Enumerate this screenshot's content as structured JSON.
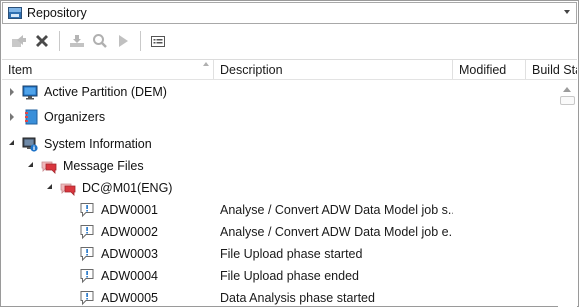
{
  "window": {
    "title": "Repository"
  },
  "toolbar": {
    "buttons": [
      {
        "icon": "open-arrow-icon",
        "enabled": false
      },
      {
        "icon": "delete-x-icon",
        "enabled": true
      },
      {
        "icon": "import-download-icon",
        "enabled": false
      },
      {
        "icon": "search-icon",
        "enabled": false
      },
      {
        "icon": "play-icon",
        "enabled": false
      },
      {
        "icon": "properties-list-icon",
        "enabled": true
      }
    ]
  },
  "columns": [
    "Item",
    "Description",
    "Modified",
    "Build Sta"
  ],
  "tree": [
    {
      "label": "Active Partition (DEM)",
      "description": "",
      "icon": "monitor-icon",
      "expander": "collapsed"
    },
    {
      "label": "Organizers",
      "description": "",
      "icon": "organizer-book-icon",
      "expander": "collapsed"
    },
    {
      "label": "System Information",
      "description": "",
      "icon": "system-info-icon",
      "expander": "expanded"
    },
    {
      "label": "Message Files",
      "description": "",
      "icon": "message-files-icon",
      "expander": "expanded"
    },
    {
      "label": "DC@M01(ENG)",
      "description": "",
      "icon": "message-files-icon",
      "expander": "expanded"
    },
    {
      "label": "ADW0001",
      "description": "Analyse / Convert ADW Data Model job s...",
      "icon": "message-icon",
      "expander": "none"
    },
    {
      "label": "ADW0002",
      "description": "Analyse / Convert ADW Data Model job e...",
      "icon": "message-icon",
      "expander": "none"
    },
    {
      "label": "ADW0003",
      "description": "File Upload phase started",
      "icon": "message-icon",
      "expander": "none"
    },
    {
      "label": "ADW0004",
      "description": "File Upload phase ended",
      "icon": "message-icon",
      "expander": "none"
    },
    {
      "label": "ADW0005",
      "description": "Data Analysis phase started",
      "icon": "message-icon",
      "expander": "none"
    }
  ],
  "colors": {
    "accent_blue": "#2f6fb0",
    "message_red": "#d9363e",
    "info_blue": "#1e73c8"
  }
}
